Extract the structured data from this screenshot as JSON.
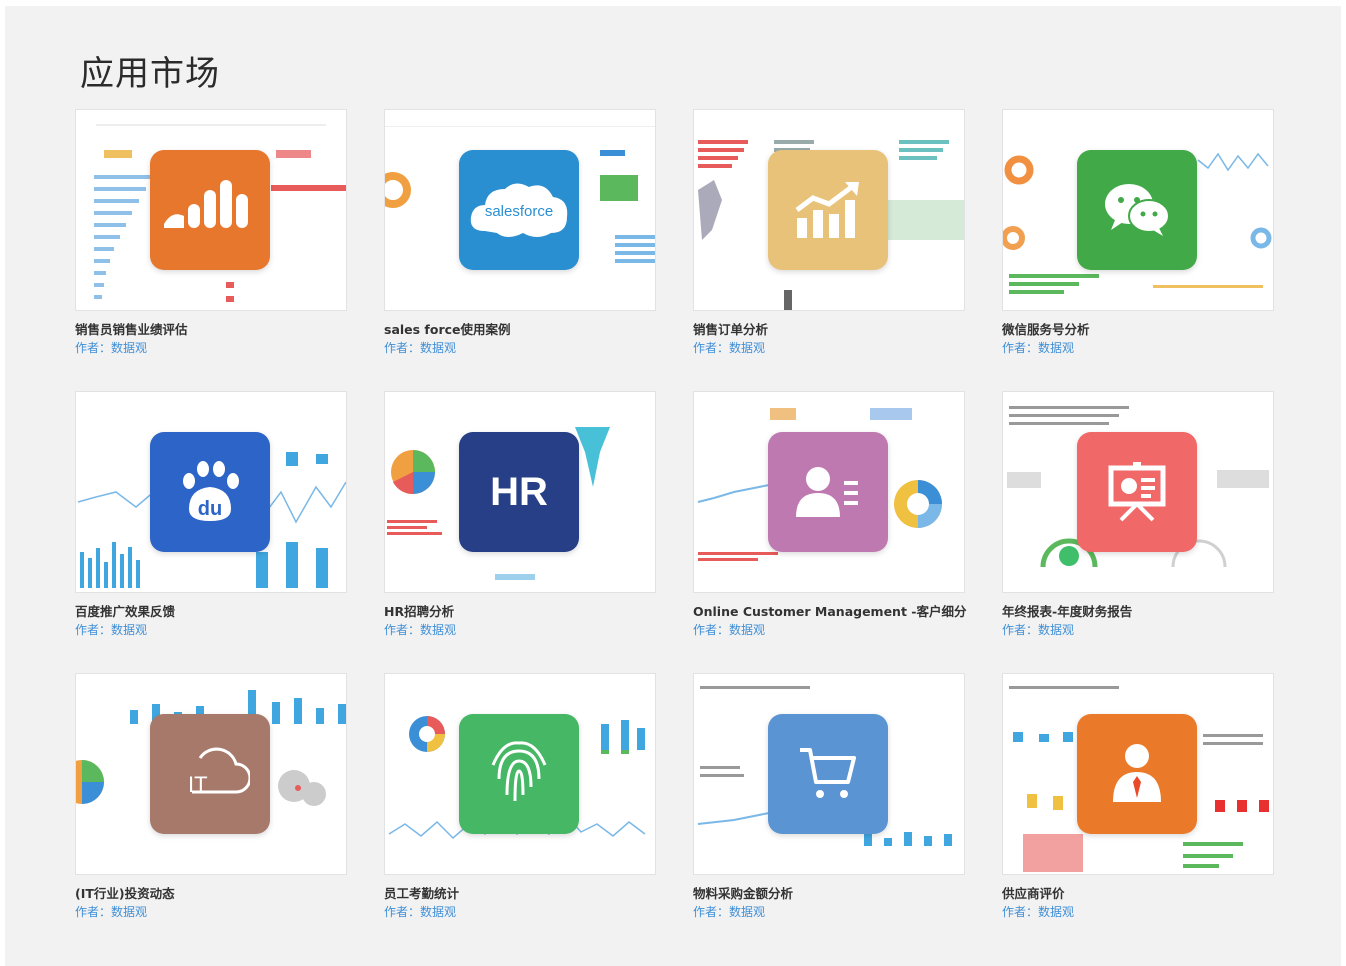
{
  "page": {
    "title": "应用市场"
  },
  "author_prefix": "作者：",
  "apps": [
    {
      "name": "销售员销售业绩评估",
      "author": "数据观",
      "icon": "bar-chart-icon",
      "color": "#e8772e"
    },
    {
      "name": "sales force使用案例",
      "author": "数据观",
      "icon": "salesforce-cloud-icon",
      "color": "#2a8fd1",
      "icon_text": "salesforce"
    },
    {
      "name": "销售订单分析",
      "author": "数据观",
      "icon": "trend-up-chart-icon",
      "color": "#e9c27a"
    },
    {
      "name": "微信服务号分析",
      "author": "数据观",
      "icon": "wechat-icon",
      "color": "#42a948"
    },
    {
      "name": "百度推广效果反馈",
      "author": "数据观",
      "icon": "baidu-paw-icon",
      "color": "#2d64c8",
      "icon_text": "du"
    },
    {
      "name": "HR招聘分析",
      "author": "数据观",
      "icon": "hr-icon",
      "color": "#263f86",
      "icon_text": "HR"
    },
    {
      "name": "Online Customer Management -客户细分",
      "author": "数据观",
      "icon": "user-list-icon",
      "color": "#be79b0"
    },
    {
      "name": "年终报表-年度财务报告",
      "author": "数据观",
      "icon": "presentation-board-icon",
      "color": "#f06868"
    },
    {
      "name": "(IT行业)投资动态",
      "author": "数据观",
      "icon": "it-cloud-icon",
      "color": "#a6796a",
      "icon_text": "IT"
    },
    {
      "name": "员工考勤统计",
      "author": "数据观",
      "icon": "fingerprint-icon",
      "color": "#45b765"
    },
    {
      "name": "物料采购金额分析",
      "author": "数据观",
      "icon": "shopping-cart-icon",
      "color": "#5b94d3"
    },
    {
      "name": "供应商评价",
      "author": "数据观",
      "icon": "supplier-person-icon",
      "color": "#ea7a2a"
    }
  ]
}
